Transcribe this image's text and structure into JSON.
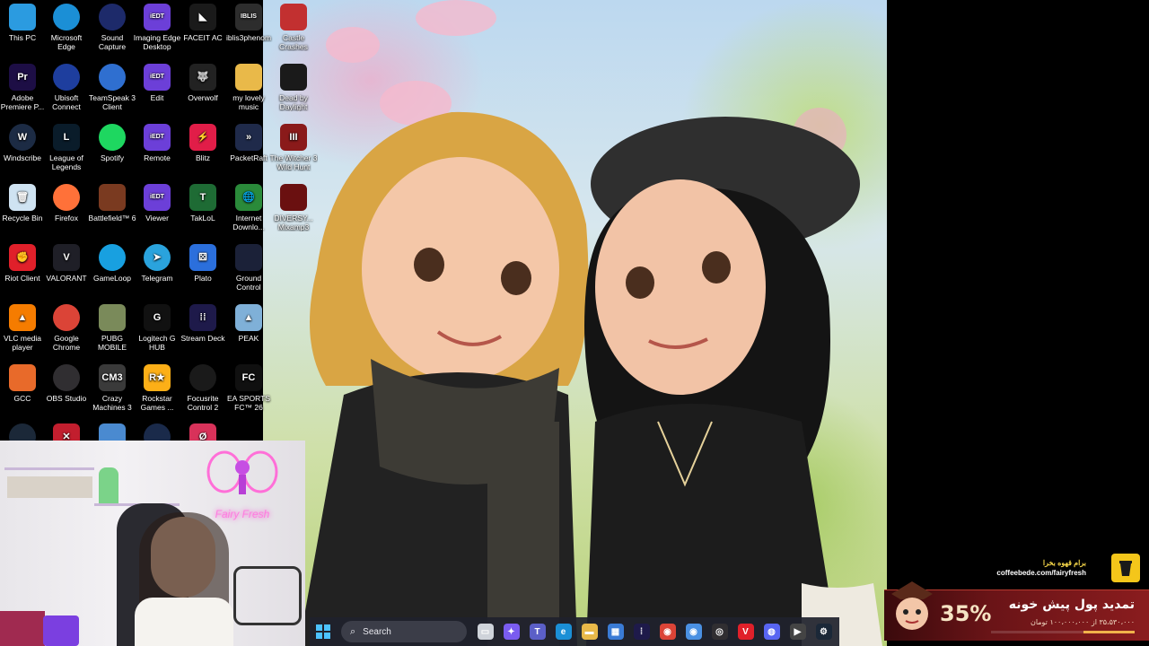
{
  "desktop": {
    "icons": [
      {
        "label": "This PC",
        "icon": "monitor-icon",
        "col": 0,
        "row": 0,
        "color": "#2b9be0"
      },
      {
        "label": "Microsoft Edge",
        "icon": "edge-icon",
        "col": 1,
        "row": 0,
        "color": "#1b8fd6"
      },
      {
        "label": "Sound Capture",
        "icon": "sound-capture-icon",
        "col": 2,
        "row": 0,
        "color": "#1d2a6a"
      },
      {
        "label": "Imaging Edge Desktop",
        "icon": "iedt-icon",
        "col": 3,
        "row": 0,
        "color": "#6c3fd8",
        "glyph": "iEDT"
      },
      {
        "label": "FACEIT AC",
        "icon": "faceit-icon",
        "col": 4,
        "row": 0,
        "color": "#1a1a1a",
        "glyph": "◣"
      },
      {
        "label": "iblis3phenom",
        "icon": "iblis-icon",
        "col": 5,
        "row": 0,
        "color": "#2d2d2d",
        "glyph": "IBLIS"
      },
      {
        "label": "Castle Crashes",
        "icon": "castle-crashes-icon",
        "col": 6,
        "row": 0,
        "color": "#c23030"
      },
      {
        "label": "Adobe Premiere P...",
        "icon": "premiere-icon",
        "col": 0,
        "row": 1,
        "color": "#1d0e45",
        "glyph": "Pr"
      },
      {
        "label": "Ubisoft Connect",
        "icon": "ubisoft-icon",
        "col": 1,
        "row": 1,
        "color": "#1e3e9e"
      },
      {
        "label": "TeamSpeak 3 Client",
        "icon": "teamspeak-icon",
        "col": 2,
        "row": 1,
        "color": "#2f6fd0"
      },
      {
        "label": "Edit",
        "icon": "iedt-edit-icon",
        "col": 3,
        "row": 1,
        "color": "#6c3fd8",
        "glyph": "iEDT"
      },
      {
        "label": "Overwolf",
        "icon": "overwolf-icon",
        "col": 4,
        "row": 1,
        "color": "#222",
        "glyph": "🐺"
      },
      {
        "label": "my lovely music",
        "icon": "folder-icon",
        "col": 5,
        "row": 1,
        "color": "#e9b949"
      },
      {
        "label": "Dead by Daylight",
        "icon": "dbd-icon",
        "col": 6,
        "row": 1,
        "color": "#1a1a1a"
      },
      {
        "label": "Windscribe",
        "icon": "windscribe-icon",
        "col": 0,
        "row": 2,
        "color": "#1c2b44",
        "glyph": "W"
      },
      {
        "label": "League of Legends",
        "icon": "lol-icon",
        "col": 1,
        "row": 2,
        "color": "#0a1c2a",
        "glyph": "L"
      },
      {
        "label": "Spotify",
        "icon": "spotify-icon",
        "col": 2,
        "row": 2,
        "color": "#1ed760"
      },
      {
        "label": "Remote",
        "icon": "iedt-remote-icon",
        "col": 3,
        "row": 2,
        "color": "#6c3fd8",
        "glyph": "iEDT"
      },
      {
        "label": "Blitz",
        "icon": "blitz-icon",
        "col": 4,
        "row": 2,
        "color": "#e11d48",
        "glyph": "⚡"
      },
      {
        "label": "PacketRaft",
        "icon": "packetraft-icon",
        "col": 5,
        "row": 2,
        "color": "#1f2a4a",
        "glyph": "»"
      },
      {
        "label": "The Witcher 3 Wild Hunt",
        "icon": "witcher-icon",
        "col": 6,
        "row": 2,
        "color": "#8a1a1a",
        "glyph": "III"
      },
      {
        "label": "Recycle Bin",
        "icon": "recycle-bin-icon",
        "col": 0,
        "row": 3,
        "color": "#cfe3f2",
        "glyph": "🗑"
      },
      {
        "label": "Firefox",
        "icon": "firefox-icon",
        "col": 1,
        "row": 3,
        "color": "#ff7139"
      },
      {
        "label": "Battlefield™ 6",
        "icon": "battlefield-icon",
        "col": 2,
        "row": 3,
        "color": "#7a3a20"
      },
      {
        "label": "Viewer",
        "icon": "iedt-viewer-icon",
        "col": 3,
        "row": 3,
        "color": "#6c3fd8",
        "glyph": "iEDT"
      },
      {
        "label": "TakLoL",
        "icon": "taklol-icon",
        "col": 4,
        "row": 3,
        "color": "#1e6b34",
        "glyph": "T"
      },
      {
        "label": "Internet Downlo...",
        "icon": "idm-icon",
        "col": 5,
        "row": 3,
        "color": "#2a8a3a",
        "glyph": "🌐"
      },
      {
        "label": "DIVERSY... Mixamp3",
        "icon": "diversy-icon",
        "col": 6,
        "row": 3,
        "color": "#6a1010"
      },
      {
        "label": "Riot Client",
        "icon": "riot-client-icon",
        "col": 0,
        "row": 4,
        "color": "#e0202a",
        "glyph": "✊"
      },
      {
        "label": "VALORANT",
        "icon": "valorant-icon",
        "col": 1,
        "row": 4,
        "color": "#1f1f27",
        "glyph": "V"
      },
      {
        "label": "GameLoop",
        "icon": "gameloop-icon",
        "col": 2,
        "row": 4,
        "color": "#18a0e0"
      },
      {
        "label": "Telegram",
        "icon": "telegram-icon",
        "col": 3,
        "row": 4,
        "color": "#2aa3dd",
        "glyph": "➤"
      },
      {
        "label": "Plato",
        "icon": "plato-icon",
        "col": 4,
        "row": 4,
        "color": "#2b6fdc",
        "glyph": "⚄"
      },
      {
        "label": "Ground Control",
        "icon": "ground-control-icon",
        "col": 5,
        "row": 4,
        "color": "#1b2138"
      },
      {
        "label": "VLC media player",
        "icon": "vlc-icon",
        "col": 0,
        "row": 5,
        "color": "#f57c00",
        "glyph": "▲"
      },
      {
        "label": "Google Chrome",
        "icon": "chrome-icon",
        "col": 1,
        "row": 5,
        "color": "#db4437"
      },
      {
        "label": "PUBG MOBILE",
        "icon": "pubg-icon",
        "col": 2,
        "row": 5,
        "color": "#7a8a5a"
      },
      {
        "label": "Logitech G HUB",
        "icon": "logitech-icon",
        "col": 3,
        "row": 5,
        "color": "#111",
        "glyph": "G"
      },
      {
        "label": "Stream Deck",
        "icon": "stream-deck-icon",
        "col": 4,
        "row": 5,
        "color": "#1e1a4a",
        "glyph": "⁞⁞"
      },
      {
        "label": "PEAK",
        "icon": "peak-icon",
        "col": 5,
        "row": 5,
        "color": "#7fb0d8",
        "glyph": "▲"
      },
      {
        "label": "GCC",
        "icon": "gcc-icon",
        "col": 0,
        "row": 6,
        "color": "#e86a2a"
      },
      {
        "label": "OBS Studio",
        "icon": "obs-icon",
        "col": 1,
        "row": 6,
        "color": "#302e31"
      },
      {
        "label": "Crazy Machines 3",
        "icon": "crazy-machines-icon",
        "col": 2,
        "row": 6,
        "color": "#3a3a3a",
        "glyph": "CM3"
      },
      {
        "label": "Rockstar Games ...",
        "icon": "rockstar-icon",
        "col": 3,
        "row": 6,
        "color": "#fcaf17",
        "glyph": "R★"
      },
      {
        "label": "Focusrite Control 2",
        "icon": "focusrite-icon",
        "col": 4,
        "row": 6,
        "color": "#1a1a1a"
      },
      {
        "label": "EA SPORTS FC™ 26",
        "icon": "ea-fc-icon",
        "col": 5,
        "row": 6,
        "color": "#101010",
        "glyph": "FC"
      },
      {
        "label": "",
        "icon": "steam-icon",
        "col": 0,
        "row": 7,
        "color": "#1b2838"
      },
      {
        "label": "",
        "icon": "app-x-icon",
        "col": 1,
        "row": 7,
        "color": "#c21e2e",
        "glyph": "✕"
      },
      {
        "label": "",
        "icon": "app-blue-icon",
        "col": 2,
        "row": 7,
        "color": "#4a8ad0"
      },
      {
        "label": "",
        "icon": "app-ring-icon",
        "col": 3,
        "row": 7,
        "color": "#1a2a4a"
      },
      {
        "label": "",
        "icon": "app-zero-icon",
        "col": 4,
        "row": 7,
        "color": "#d8325a",
        "glyph": "Ø"
      }
    ]
  },
  "webcam": {
    "neon_sign": "Fairy Fresh"
  },
  "taskbar": {
    "search_placeholder": "Search",
    "apps": [
      {
        "icon": "file-explorer-task-view-icon",
        "color": "#cfd3da",
        "glyph": "▭"
      },
      {
        "icon": "copilot-icon",
        "color": "#7a5cf0",
        "glyph": "✦"
      },
      {
        "icon": "teams-icon",
        "color": "#5b5fc7",
        "glyph": "T"
      },
      {
        "icon": "edge-taskbar-icon",
        "color": "#1b8fd6",
        "glyph": "e"
      },
      {
        "icon": "folder-taskbar-icon",
        "color": "#e9b949",
        "glyph": "▬"
      },
      {
        "icon": "store-icon",
        "color": "#3a7bd5",
        "glyph": "▦"
      },
      {
        "icon": "stream-deck-taskbar-icon",
        "color": "#1e1a4a",
        "glyph": "⁞"
      },
      {
        "icon": "chrome-taskbar-icon",
        "color": "#db4437",
        "glyph": "◉"
      },
      {
        "icon": "chrome-profile-taskbar-icon",
        "color": "#4a90e2",
        "glyph": "◉"
      },
      {
        "icon": "obs-taskbar-icon",
        "color": "#302e31",
        "glyph": "◎"
      },
      {
        "icon": "valorant-taskbar-icon",
        "color": "#e0202a",
        "glyph": "V"
      },
      {
        "icon": "discord-icon",
        "color": "#5865f2",
        "glyph": "◍"
      },
      {
        "icon": "media-player-icon",
        "color": "#444",
        "glyph": "▶"
      },
      {
        "icon": "steam-taskbar-icon",
        "color": "#1b2838",
        "glyph": "⚙"
      }
    ]
  },
  "promo": {
    "coffee_title": "برام قهوه بخرا",
    "coffee_url": "coffeebede.com/fairyfresh",
    "discount": "35%",
    "headline": "تمدید پول پیش خونه",
    "amount": "۳۵،۵۳۰،۰۰۰ از ۱۰۰،۰۰۰،۰۰۰ تومان",
    "progress": 0.355
  }
}
